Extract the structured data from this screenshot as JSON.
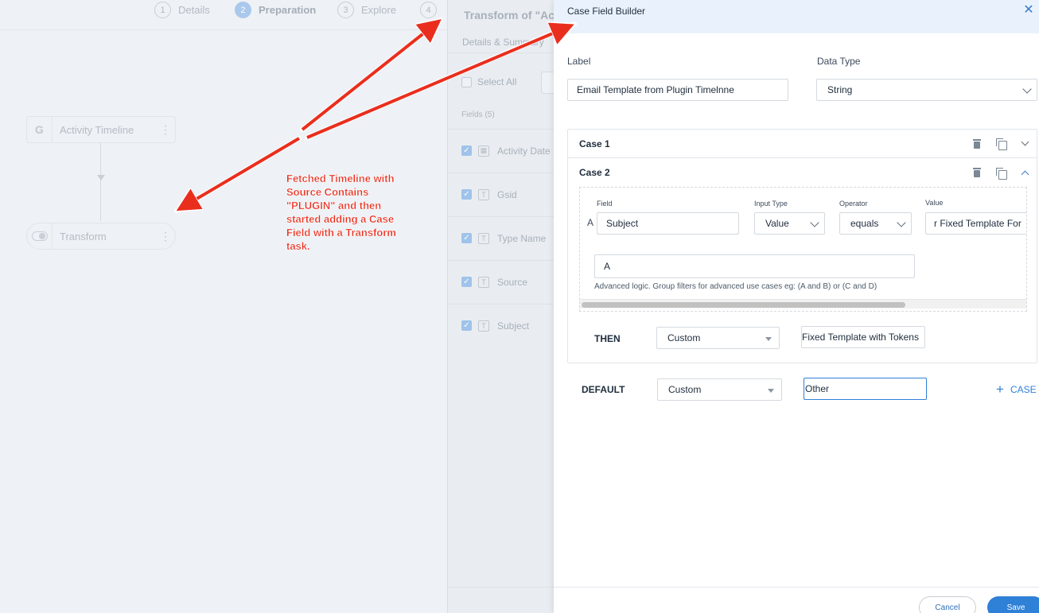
{
  "stepper": {
    "steps": [
      {
        "num": "1",
        "label": "Details"
      },
      {
        "num": "2",
        "label": "Preparation"
      },
      {
        "num": "3",
        "label": "Explore"
      },
      {
        "num": "4",
        "label": ""
      }
    ]
  },
  "canvas": {
    "nodes": [
      {
        "icon": "G",
        "label": "Activity Timeline"
      },
      {
        "icon": "toggle",
        "label": "Transform"
      }
    ],
    "annotation": "Fetched Timeline with Source Contains \"PLUGIN\" and then started adding a Case Field with a Transform task."
  },
  "transform_panel": {
    "title": "Transform of \"Act",
    "subtab": "Details & Summary",
    "select_all": "Select All",
    "fields_label": "Fields (5)",
    "fields": [
      "Activity Date",
      "Gsid",
      "Type Name",
      "Source",
      "Subject"
    ]
  },
  "builder": {
    "title": "Case Field Builder",
    "label_caption": "Label",
    "label_value": "Email Template from Plugin Timelnne",
    "datatype_caption": "Data Type",
    "datatype_value": "String",
    "cases": [
      {
        "title": "Case 1"
      },
      {
        "title": "Case 2"
      }
    ],
    "filter": {
      "field_caption": "Field",
      "input_type_caption": "Input Type",
      "operator_caption": "Operator",
      "value_caption": "Value",
      "row_letter": "A",
      "field_value": "Subject",
      "input_type_value": "Value",
      "operator_value": "equals",
      "value_value": "r Fixed Template For",
      "advanced_value": "A",
      "advanced_hint": "Advanced logic. Group filters for advanced use cases eg: (A and B) or (C and D)"
    },
    "then": {
      "label": "THEN",
      "select_value": "Custom",
      "input_value": "Fixed Template with Tokens"
    },
    "default": {
      "label": "DEFAULT",
      "select_value": "Custom",
      "input_value": "Other"
    },
    "add_case_label": "CASE",
    "cancel_label": "Cancel",
    "save_label": "Save"
  },
  "colors": {
    "accent": "#2f80d7",
    "annotation": "#ea2e1d",
    "header_bg": "#e9f2fc"
  }
}
